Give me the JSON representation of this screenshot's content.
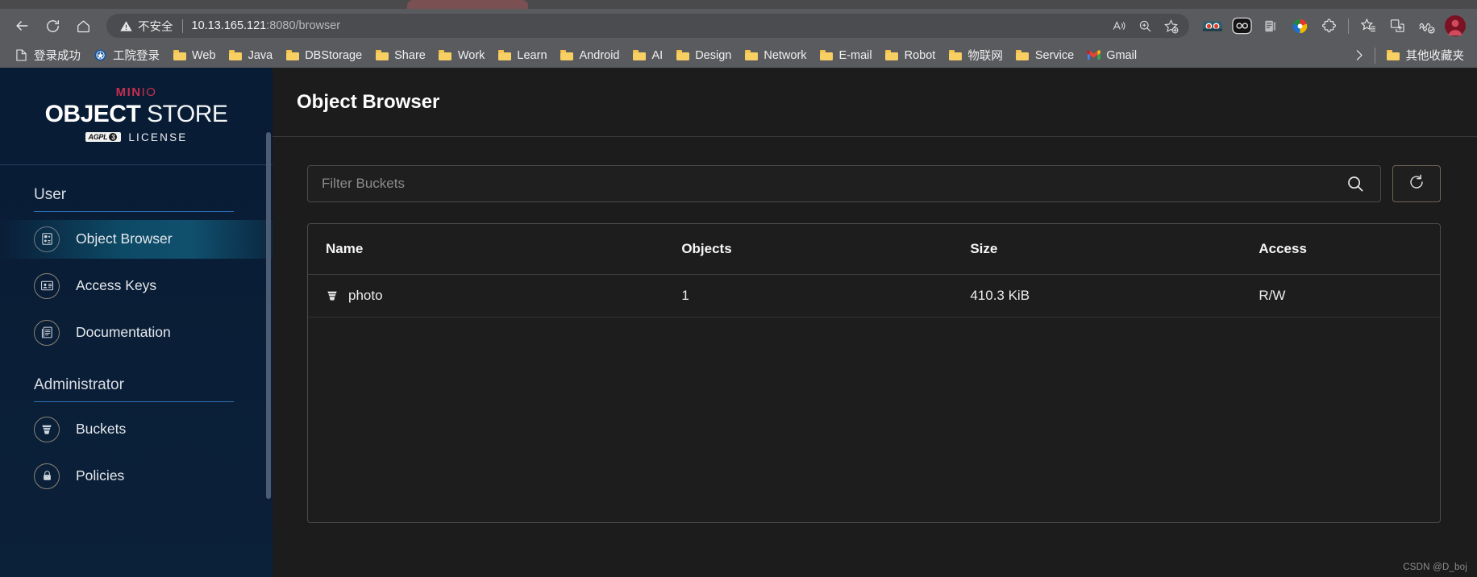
{
  "browser": {
    "nav": [
      {
        "name": "back-button",
        "icon": "arrow-left-icon"
      },
      {
        "name": "reload-button",
        "icon": "reload-icon"
      },
      {
        "name": "home-button",
        "icon": "home-icon"
      }
    ],
    "omnibox": {
      "security_label": "不安全",
      "security_icon": "warning-triangle-icon",
      "url_host": "10.13.165.121",
      "url_rest": ":8080/browser",
      "right_icons": [
        "read-aloud-icon",
        "zoom-icon",
        "add-favorite-icon"
      ]
    },
    "extensions": [
      "profile-avatar-icon",
      "glasses-extension-icon",
      "reading-list-icon",
      "idm-extension-icon",
      "puzzle-extension-icon",
      "collections-star-icon",
      "split-screen-icon",
      "browser-essentials-icon",
      "user-avatar-icon"
    ]
  },
  "bookmarks": {
    "items": [
      {
        "label": "登录成功",
        "icon": "page-icon"
      },
      {
        "label": "工院登录",
        "icon": "site-icon"
      },
      {
        "label": "Web",
        "icon": "folder-icon"
      },
      {
        "label": "Java",
        "icon": "folder-icon"
      },
      {
        "label": "DBStorage",
        "icon": "folder-icon"
      },
      {
        "label": "Share",
        "icon": "folder-icon"
      },
      {
        "label": "Work",
        "icon": "folder-icon"
      },
      {
        "label": "Learn",
        "icon": "folder-icon"
      },
      {
        "label": "Android",
        "icon": "folder-icon"
      },
      {
        "label": "AI",
        "icon": "folder-icon"
      },
      {
        "label": "Design",
        "icon": "folder-icon"
      },
      {
        "label": "Network",
        "icon": "folder-icon"
      },
      {
        "label": "E-mail",
        "icon": "folder-icon"
      },
      {
        "label": "Robot",
        "icon": "folder-icon"
      },
      {
        "label": "物联网",
        "icon": "folder-icon"
      },
      {
        "label": "Service",
        "icon": "folder-icon"
      },
      {
        "label": "Gmail",
        "icon": "gmail-icon"
      }
    ],
    "overflow_icon": "chevron-right-icon",
    "other_favorites": {
      "label": "其他收藏夹",
      "icon": "folder-icon"
    }
  },
  "sidebar": {
    "logo": {
      "brand": "MIN",
      "brand_o": "IO",
      "title_bold": "OBJECT",
      "title_thin": " STORE",
      "badge": "AGPL",
      "badge_version": "3",
      "license": "LICENSE"
    },
    "sections": [
      {
        "title": "User",
        "items": [
          {
            "label": "Object Browser",
            "icon": "object-browser-icon",
            "active": true
          },
          {
            "label": "Access Keys",
            "icon": "access-keys-icon",
            "active": false
          },
          {
            "label": "Documentation",
            "icon": "documentation-icon",
            "active": false
          }
        ]
      },
      {
        "title": "Administrator",
        "items": [
          {
            "label": "Buckets",
            "icon": "bucket-icon",
            "active": false
          },
          {
            "label": "Policies",
            "icon": "lock-icon",
            "active": false
          }
        ]
      }
    ]
  },
  "main": {
    "page_title": "Object Browser",
    "filter": {
      "placeholder": "Filter Buckets",
      "value": "",
      "search_icon": "search-icon",
      "refresh_icon": "refresh-icon"
    },
    "table": {
      "columns": [
        "Name",
        "Objects",
        "Size",
        "Access"
      ],
      "rows": [
        {
          "name": "photo",
          "objects": "1",
          "size": "410.3 KiB",
          "access": "R/W",
          "icon": "bucket-icon"
        }
      ]
    }
  },
  "watermark": "CSDN @D_boj",
  "colors": {
    "accent_red": "#c72e4d",
    "sidebar_bg": "#0a1d36",
    "active_nav": "#0d4a66",
    "main_bg": "#1c1c1c",
    "section_underline": "#2f6fb5"
  }
}
